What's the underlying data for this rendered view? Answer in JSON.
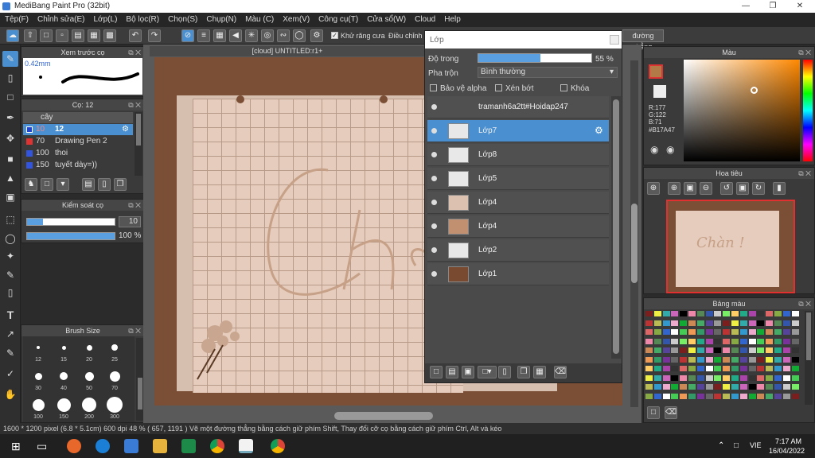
{
  "title": "MediBang Paint Pro (32bit)",
  "menu": [
    "Tệp(F)",
    "Chỉnh sửa(E)",
    "Lớp(L)",
    "Bộ lọc(R)",
    "Chọn(S)",
    "Chụp(N)",
    "Màu (C)",
    "Xem(V)",
    "Công cụ(T)",
    "Cửa sổ(W)",
    "Cloud",
    "Help"
  ],
  "toolbar": {
    "antialias": "Khử răng cưa",
    "adjust": "Điều chỉnh",
    "straight": "đường thẳng"
  },
  "preview": {
    "title": "Xem trước cọ",
    "size": "0.42mm"
  },
  "brush": {
    "title": "Cọ: 12",
    "group": "cây",
    "items": [
      {
        "size": "10",
        "name": "12",
        "color": "#2244cc"
      },
      {
        "size": "70",
        "name": "Drawing Pen 2",
        "color": "#dd3333"
      },
      {
        "size": "100",
        "name": "thoi",
        "color": "#3355dd"
      },
      {
        "size": "150",
        "name": "tuyết dày=))",
        "color": "#3355dd"
      }
    ]
  },
  "control": {
    "title": "Kiểm soát cọ",
    "size": "10",
    "opacity": "100 %"
  },
  "brushSize": {
    "title": "Brush Size",
    "labels": [
      "12",
      "15",
      "20",
      "25",
      "30",
      "40",
      "50",
      "70",
      "100",
      "150",
      "200",
      "300"
    ]
  },
  "canvas": {
    "tab": "[cloud] UNTITLED:r1+"
  },
  "layers": {
    "title": "Lớp",
    "opacityLabel": "Độ trong",
    "opacity": "55 %",
    "blendLabel": "Pha trộn",
    "blend": "Bình thường",
    "protect": "Bảo vệ alpha",
    "clip": "Xén bớt",
    "lock": "Khóa",
    "items": [
      {
        "name": "tramanh6a2tt#Hoidap247",
        "thumb": "#505050",
        "sel": false
      },
      {
        "name": "Lớp7",
        "thumb": "#e8e8e8",
        "sel": true
      },
      {
        "name": "Lớp8",
        "thumb": "#e8e8e8",
        "sel": false
      },
      {
        "name": "Lớp5",
        "thumb": "#e8e8e8",
        "sel": false
      },
      {
        "name": "Lớp4",
        "thumb": "#dcc0b0",
        "sel": false
      },
      {
        "name": "Lớp4",
        "thumb": "#c09070",
        "sel": false
      },
      {
        "name": "Lớp2",
        "thumb": "#e8e8e8",
        "sel": false
      },
      {
        "name": "Lớp1",
        "thumb": "#7a4a30",
        "sel": false
      }
    ]
  },
  "color": {
    "title": "Màu",
    "r": "R:177",
    "g": "G:122",
    "b": "B:71",
    "hex": "#B17A47"
  },
  "navigator": {
    "title": "Hoa tiêu",
    "text": "Chàn !"
  },
  "palette": {
    "title": "Bảng màu"
  },
  "status": "1600 * 1200 pixel  (6.8 * 5.1cm)  600 dpi  48 %  ( 657, 1191 )  Vẽ một đường thẳng bằng cách giữ phím Shift, Thay đổi cỡ cọ bằng cách giữ phím Ctrl, Alt và kéo",
  "taskbar": {
    "lang": "VIE",
    "time": "7:17 AM",
    "date": "16/04/2022"
  }
}
